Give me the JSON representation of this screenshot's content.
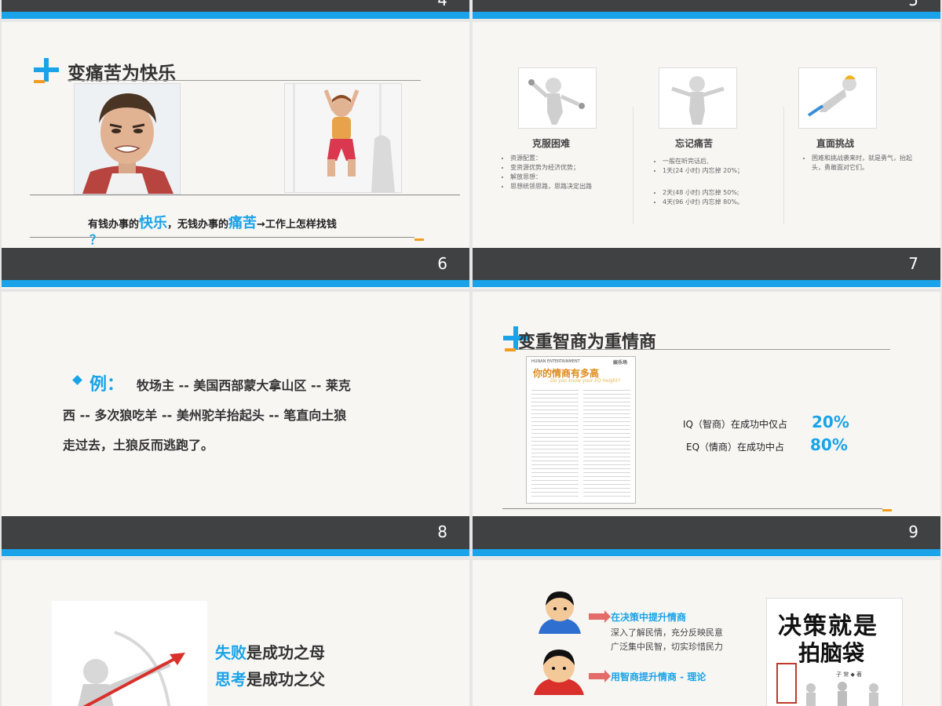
{
  "slides": {
    "s4": {
      "number": "4"
    },
    "s5": {
      "number": "5"
    },
    "s6": {
      "title": "变痛苦为快乐",
      "caption": {
        "p1": "有钱办事的",
        "h1": "快乐",
        "p2": "，无钱办事的",
        "h2": "痛苦",
        "p3": "→工作上怎样找钱",
        "p4": "？"
      },
      "number": "6"
    },
    "s7": {
      "columns": [
        {
          "title": "克服困难",
          "bullets": [
            "资源配置：",
            "变资源优势为经济优势；",
            "解放思想：",
            "思想统领思路，思路决定出路"
          ]
        },
        {
          "title": "忘记痛苦",
          "bullets": [
            "一般在听完话后,",
            "1天(24 小时) 内忘掉 20%；",
            "2天(48 小时) 内忘掉 50%;",
            "4天(96 小时) 内忘掉 80%。"
          ]
        },
        {
          "title": "直面挑战",
          "bullets": [
            "困难和挑战袭来时，就是勇气，抬起头，勇敢面对它们。"
          ]
        }
      ],
      "number": "7"
    },
    "s8": {
      "label": "例：",
      "line1": "牧场主 -- 美国西部蒙大拿山区 -- 莱克",
      "line2": "西 -- 多次狼吃羊 -- 美州驼羊抬起头 -- 笔直向土狼",
      "line3": "走过去，土狼反而逃跑了。",
      "number": "8"
    },
    "s9": {
      "title": "变重智商为重情商",
      "doc_header_left": "HUNAN  ENTERTAINMENT",
      "doc_header_right": "娱乐场",
      "doc_title": "你的情商有多高",
      "doc_subtitle": "Do you know your EQ height?",
      "iq_label": "IQ（智商）在成功中仅占",
      "iq_value": "20%",
      "eq_label": "EQ（情商）在成功中占",
      "eq_value": "80%",
      "number": "9"
    },
    "s10": {
      "line1_accent": "失败",
      "line1_rest": "是成功之母",
      "line2_accent": "思考",
      "line2_rest": "是成功之父"
    },
    "s11": {
      "item1_title": "在决策中提升情商",
      "item1_text1": "深入了解民情，充分反映民意",
      "item1_text2": "广泛集中民智，切实珍惜民力",
      "item2_title": "用智商提升情商 - 理论",
      "book_title_1": "决策就是",
      "book_title_2": "拍脑袋",
      "book_author": "子 常 ◆ 著"
    }
  },
  "colors": {
    "accent": "#1aa3e8",
    "orange": "#f39c1e",
    "dark": "#404142",
    "bg": "#f7f6f3"
  }
}
